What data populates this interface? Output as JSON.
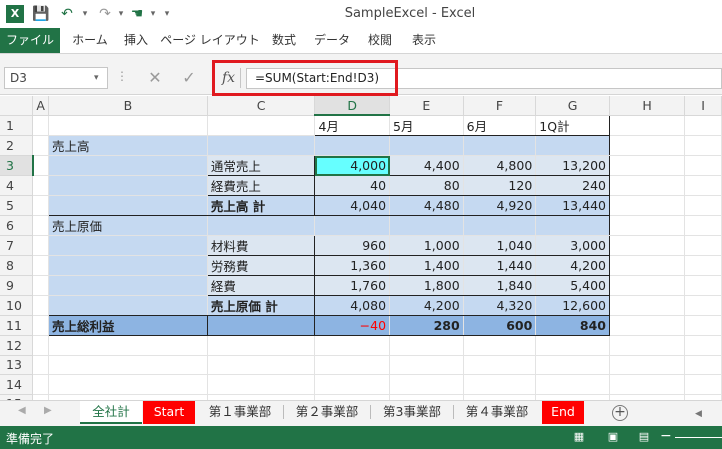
{
  "app": {
    "window_title": "SampleExcel - Excel",
    "logo_text": "X",
    "colors": {
      "accent": "#217346",
      "header_blue": "#c5d9f1",
      "sub_blue": "#dce6f1",
      "total_blue": "#8db4e2",
      "selected_cell": "#66ffff",
      "negative": "#ff0000",
      "highlight": "#e0191f"
    }
  },
  "quick_access": {
    "save_icon": "💾",
    "undo_icon": "↶",
    "redo_icon": "↷",
    "touch_icon": "☚",
    "customize_icon": "▾"
  },
  "ribbon": {
    "tabs": [
      "ファイル",
      "ホーム",
      "挿入",
      "ページ レイアウト",
      "数式",
      "データ",
      "校閲",
      "表示"
    ]
  },
  "formula_bar": {
    "name_box": "D3",
    "cancel_icon": "✕",
    "enter_icon": "✓",
    "fx_label": "fx",
    "formula": "=SUM(Start:End!D3)"
  },
  "grid": {
    "columns": [
      "",
      "A",
      "B",
      "C",
      "D",
      "E",
      "F",
      "G",
      "H",
      "I"
    ],
    "rows": [
      {
        "n": "1",
        "b": "",
        "c": "",
        "d": "4月",
        "e": "5月",
        "f": "6月",
        "g": "1Q計"
      },
      {
        "n": "2",
        "b": "売上高",
        "c": "",
        "d": "",
        "e": "",
        "f": "",
        "g": ""
      },
      {
        "n": "3",
        "b": "",
        "c": "通常売上",
        "d": "4,000",
        "e": "4,400",
        "f": "4,800",
        "g": "13,200"
      },
      {
        "n": "4",
        "b": "",
        "c": "経費売上",
        "d": "40",
        "e": "80",
        "f": "120",
        "g": "240"
      },
      {
        "n": "5",
        "b": "",
        "c": "売上高 計",
        "d": "4,040",
        "e": "4,480",
        "f": "4,920",
        "g": "13,440"
      },
      {
        "n": "6",
        "b": "売上原価",
        "c": "",
        "d": "",
        "e": "",
        "f": "",
        "g": ""
      },
      {
        "n": "7",
        "b": "",
        "c": "材料費",
        "d": "960",
        "e": "1,000",
        "f": "1,040",
        "g": "3,000"
      },
      {
        "n": "8",
        "b": "",
        "c": "労務費",
        "d": "1,360",
        "e": "1,400",
        "f": "1,440",
        "g": "4,200"
      },
      {
        "n": "9",
        "b": "",
        "c": "経費",
        "d": "1,760",
        "e": "1,800",
        "f": "1,840",
        "g": "5,400"
      },
      {
        "n": "10",
        "b": "",
        "c": "売上原価 計",
        "d": "4,080",
        "e": "4,200",
        "f": "4,320",
        "g": "12,600"
      },
      {
        "n": "11",
        "b": "売上総利益",
        "c": "",
        "d": "−40",
        "e": "280",
        "f": "600",
        "g": "840"
      },
      {
        "n": "12"
      },
      {
        "n": "13"
      },
      {
        "n": "14"
      },
      {
        "n": "15"
      }
    ]
  },
  "sheet_tabs": {
    "nav_prev": "◀",
    "nav_next": "▶",
    "tabs": [
      "全社計",
      "Start",
      "第１事業部",
      "第２事業部",
      "第3事業部",
      "第４事業部",
      "End"
    ],
    "add_icon": "+",
    "scroll_icon": "◀"
  },
  "status": {
    "text": "準備完了",
    "normal_view_icon": "▦",
    "page_layout_icon": "▣",
    "page_break_icon": "▤",
    "zoom_minus": "−"
  }
}
